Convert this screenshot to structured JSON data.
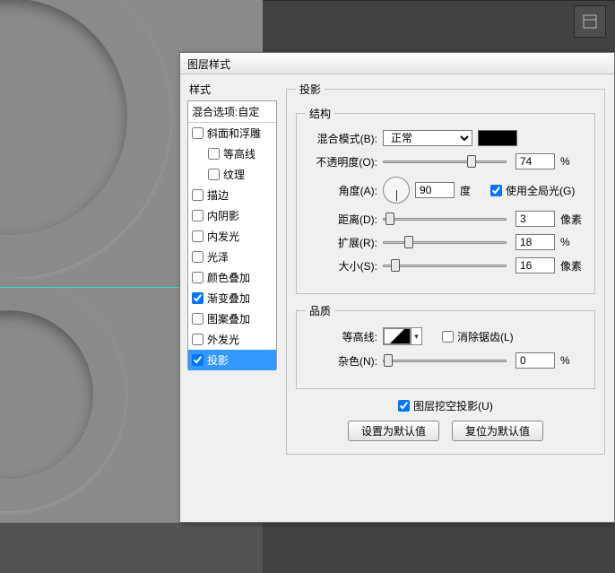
{
  "dialog": {
    "title": "图层样式",
    "styles_label": "样式",
    "blend_options": "混合选项:自定",
    "items": [
      {
        "label": "斜面和浮雕",
        "checked": false,
        "indent": false
      },
      {
        "label": "等高线",
        "checked": false,
        "indent": true
      },
      {
        "label": "纹理",
        "checked": false,
        "indent": true
      },
      {
        "label": "描边",
        "checked": false,
        "indent": false
      },
      {
        "label": "内阴影",
        "checked": false,
        "indent": false
      },
      {
        "label": "内发光",
        "checked": false,
        "indent": false
      },
      {
        "label": "光泽",
        "checked": false,
        "indent": false
      },
      {
        "label": "颜色叠加",
        "checked": false,
        "indent": false
      },
      {
        "label": "渐变叠加",
        "checked": true,
        "indent": false
      },
      {
        "label": "图案叠加",
        "checked": false,
        "indent": false
      },
      {
        "label": "外发光",
        "checked": false,
        "indent": false
      },
      {
        "label": "投影",
        "checked": true,
        "indent": false,
        "selected": true
      }
    ]
  },
  "panel": {
    "section": "投影",
    "structure": "结构",
    "blend_mode_label": "混合模式(B):",
    "blend_mode_value": "正常",
    "color": "#000000",
    "opacity_label": "不透明度(O):",
    "opacity_value": "74",
    "percent": "%",
    "angle_label": "角度(A):",
    "angle_value": "90",
    "degree": "度",
    "global_light_label": "使用全局光(G)",
    "global_light": true,
    "distance_label": "距离(D):",
    "distance_value": "3",
    "px": "像素",
    "spread_label": "扩展(R):",
    "spread_value": "18",
    "size_label": "大小(S):",
    "size_value": "16",
    "quality": "品质",
    "contour_label": "等高线:",
    "antialias_label": "消除锯齿(L)",
    "antialias": false,
    "noise_label": "杂色(N):",
    "noise_value": "0",
    "knockout_label": "图层挖空投影(U)",
    "knockout": true,
    "btn_default": "设置为默认值",
    "btn_reset": "复位为默认值"
  }
}
